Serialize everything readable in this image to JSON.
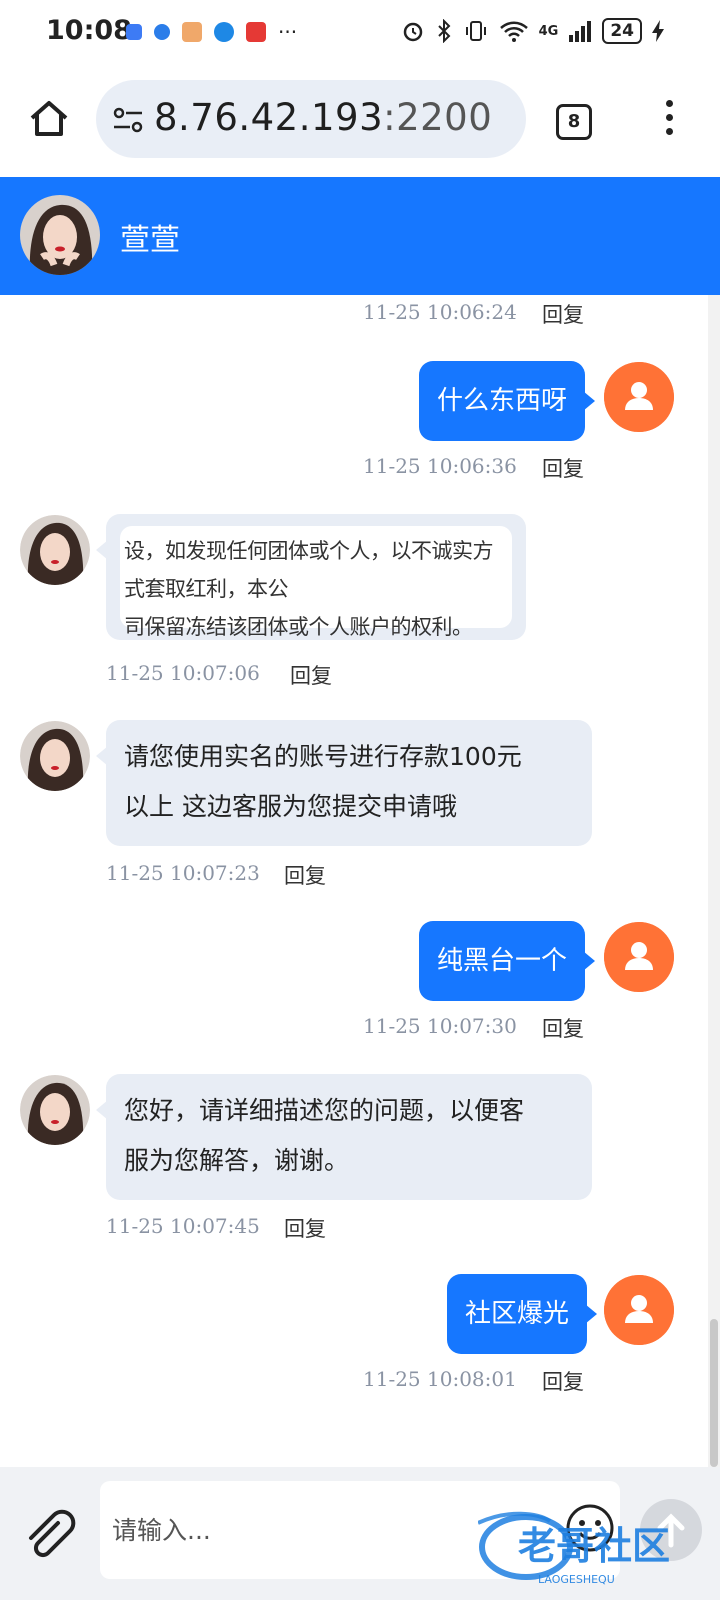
{
  "status_bar": {
    "time": "10:08",
    "overflow": "···",
    "network": "4G",
    "battery": "24"
  },
  "browser": {
    "url_host": "8.76.42.193",
    "url_port": ":2200",
    "tab_count": "8"
  },
  "chat": {
    "contact_name": "萱萱",
    "reply_label": "回复",
    "messages": [
      {
        "side": "left",
        "time": "11-25 10:06:24"
      },
      {
        "side": "right",
        "text": "什么东西呀",
        "time": "11-25 10:06:36"
      },
      {
        "side": "left",
        "type": "image",
        "image_text_line1": "设，如发现任何团体或个人，以不诚实方式套取红利，本公",
        "image_text_line2": "司保留冻结该团体或个人账户的权利。",
        "time": "11-25 10:07:06"
      },
      {
        "side": "left",
        "text_line1": "请您使用实名的账号进行存款100元",
        "text_line2": "以上 这边客服为您提交申请哦",
        "time": "11-25 10:07:23"
      },
      {
        "side": "right",
        "text": "纯黑台一个",
        "time": "11-25 10:07:30"
      },
      {
        "side": "left",
        "text_line1": "您好，请详细描述您的问题，以便客",
        "text_line2": "服为您解答，谢谢。",
        "time": "11-25 10:07:45"
      },
      {
        "side": "right",
        "text": "社区爆光",
        "time": "11-25 10:08:01"
      }
    ]
  },
  "composer": {
    "placeholder": "请输入..."
  },
  "watermark": {
    "text": "老哥社区",
    "subtext": "LAOGESHEQU"
  },
  "colors": {
    "header_blue": "#1677ff",
    "user_avatar_orange": "#ff7236",
    "agent_bubble": "#e8edf5"
  }
}
